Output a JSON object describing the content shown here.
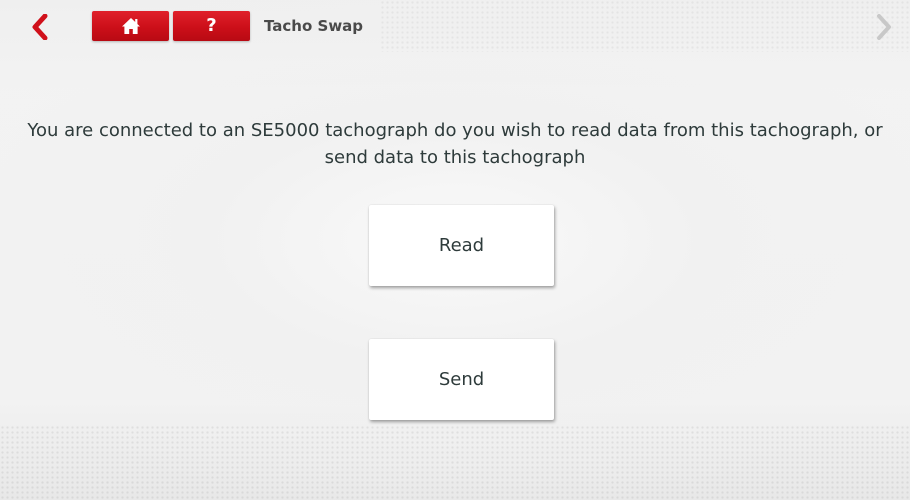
{
  "header": {
    "back_icon": "chevron-left-icon",
    "home_icon": "home-icon",
    "help_label": "?",
    "title": "Tacho Swap",
    "forward_icon": "chevron-right-icon"
  },
  "main": {
    "message": "You are connected to an SE5000 tachograph do you wish to read data from this tachograph, or send data to this tachograph",
    "read_label": "Read",
    "send_label": "Send"
  },
  "colors": {
    "accent": "#d0101a",
    "text": "#2e3b3b",
    "background": "#efefef",
    "button": "#ffffff"
  }
}
